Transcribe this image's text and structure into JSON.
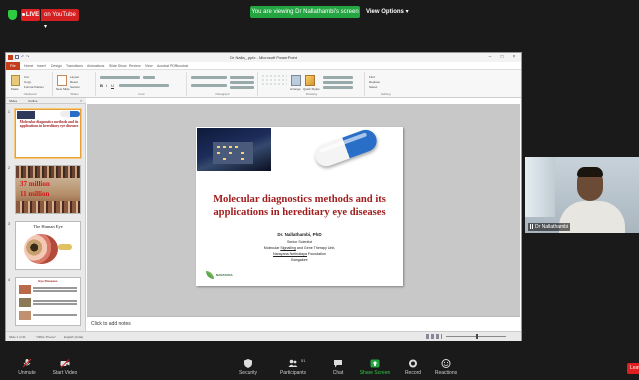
{
  "zoom_top": {
    "live_label": "LIVE",
    "youtube_label": "on YouTube ▾",
    "viewing_banner": "You are viewing Dr Nallathambi's screen",
    "view_options": "View Options ▾"
  },
  "ppt": {
    "window_title": "Dr Nalla_.pptx - Microsoft PowerPoint",
    "tabs": [
      "File",
      "Home",
      "Insert",
      "Design",
      "Transitions",
      "Animations",
      "Slide Show",
      "Review",
      "View",
      "Acrobat PDF",
      "Acrobat"
    ],
    "ribbon_groups": [
      "Clipboard",
      "Slides",
      "Font",
      "Paragraph",
      "Drawing",
      "Editing"
    ],
    "ribbon_items": {
      "cut": "Cut",
      "copy": "Copy",
      "format_painter": "Format Painter",
      "paste": "Paste",
      "new_slide": "New Slide",
      "layout": "Layout",
      "reset": "Reset",
      "section": "Section",
      "arrange": "Arrange",
      "quick_styles": "Quick Styles",
      "find": "Find",
      "replace": "Replace",
      "select": "Select"
    },
    "panel_tabs": [
      "Slides",
      "Outline"
    ],
    "notes_placeholder": "Click to add notes",
    "status_left": "Slide 1 of 31",
    "status_theme": "\"Office Theme\"",
    "status_lang": "English (India)"
  },
  "slide": {
    "title_line1": "Molecular diagnostics methods and its",
    "title_line2": "applications in hereditary eye diseases",
    "author": "Dr. Nallathambi, PhD",
    "role": "Senior Scientist",
    "unit_pre": "Molecular ",
    "unit_link": "Signalling",
    "unit_post": " and Gene Therapy Unit,",
    "foundation_link": "Narayana Nethralaya",
    "foundation_post": " Foundation",
    "city": "Bangalore",
    "logo_text": "NARAYANA"
  },
  "thumbnails": [
    {
      "num": "1",
      "title": "Molecular diagnostics methods and its applications in hereditary eye diseases"
    },
    {
      "num": "2",
      "line1": "37 million",
      "line2": "11 million"
    },
    {
      "num": "3",
      "title": "The Human Eye"
    },
    {
      "num": "4",
      "title": "Eye Diseases"
    }
  ],
  "video": {
    "participant_name": "Dr Nallathambi"
  },
  "toolbar": {
    "unmute": "Unmute",
    "start_video": "Start Video",
    "security": "Security",
    "participants": "Participants",
    "participants_count": "51",
    "chat": "Chat",
    "share_screen": "Share Screen",
    "record": "Record",
    "reactions": "Reactions",
    "leave": "Leave"
  },
  "colors": {
    "zoom_green": "#23a541",
    "live_red": "#e02020",
    "slide_title_red": "#a01e1e",
    "ppt_file_tab": "#c43e1c"
  }
}
